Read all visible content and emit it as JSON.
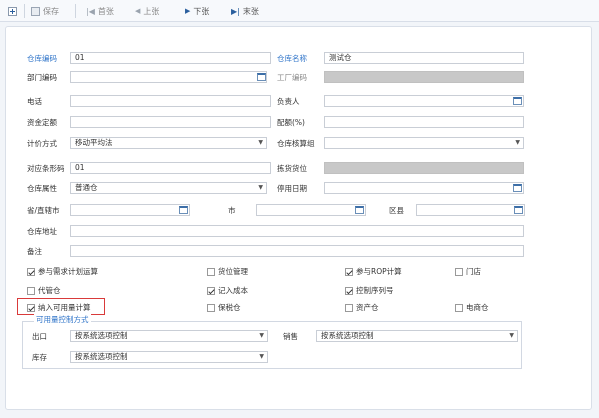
{
  "toolbar": {
    "save": "保存",
    "first": "首张",
    "prev": "上张",
    "next": "下张",
    "last": "末张"
  },
  "form": {
    "warehouse_code": {
      "label": "仓库编码",
      "value": "01"
    },
    "warehouse_name": {
      "label": "仓库名称",
      "value": "测试仓"
    },
    "dept_code": {
      "label": "部门编码",
      "value": ""
    },
    "workshop_code": {
      "label": "工厂编码",
      "value": ""
    },
    "phone": {
      "label": "电话",
      "value": ""
    },
    "manager": {
      "label": "负责人",
      "value": ""
    },
    "capital_quota": {
      "label": "资金定额",
      "value": ""
    },
    "allocation_rate": {
      "label": "配额(%)",
      "value": ""
    },
    "pricing_method": {
      "label": "计价方式",
      "value": "移动平均法"
    },
    "accounting_group": {
      "label": "仓库核算组",
      "value": ""
    },
    "barcode": {
      "label": "对应条形码",
      "value": "01"
    },
    "pick_location": {
      "label": "拣货货位",
      "value": ""
    },
    "warehouse_attr": {
      "label": "仓库属性",
      "value": "普通仓"
    },
    "disable_date": {
      "label": "停用日期",
      "value": ""
    },
    "province": {
      "label": "省/直辖市",
      "value": ""
    },
    "city": {
      "label": "市",
      "value": ""
    },
    "district": {
      "label": "区县",
      "value": ""
    },
    "address": {
      "label": "仓库地址",
      "value": ""
    },
    "remark": {
      "label": "备注",
      "value": ""
    }
  },
  "checkboxes": {
    "mrp": {
      "label": "参与需求计划运算",
      "checked": true
    },
    "location_mgmt": {
      "label": "货位管理",
      "checked": false
    },
    "rop": {
      "label": "参与ROP计算",
      "checked": true
    },
    "store": {
      "label": "门店",
      "checked": false
    },
    "consign": {
      "label": "代管仓",
      "checked": false
    },
    "cost": {
      "label": "记入成本",
      "checked": true
    },
    "serial": {
      "label": "控制序列号",
      "checked": true
    },
    "available": {
      "label": "纳入可用量计算",
      "checked": true
    },
    "bonded": {
      "label": "保税仓",
      "checked": false
    },
    "asset": {
      "label": "资产仓",
      "checked": false
    },
    "ecommerce": {
      "label": "电商仓",
      "checked": false
    }
  },
  "available_control": {
    "title": "可用量控制方式",
    "outbound": {
      "label": "出口",
      "value": "按系统选项控制"
    },
    "sales": {
      "label": "销售",
      "value": "按系统选项控制"
    },
    "inventory": {
      "label": "库存",
      "value": "按系统选项控制"
    }
  }
}
